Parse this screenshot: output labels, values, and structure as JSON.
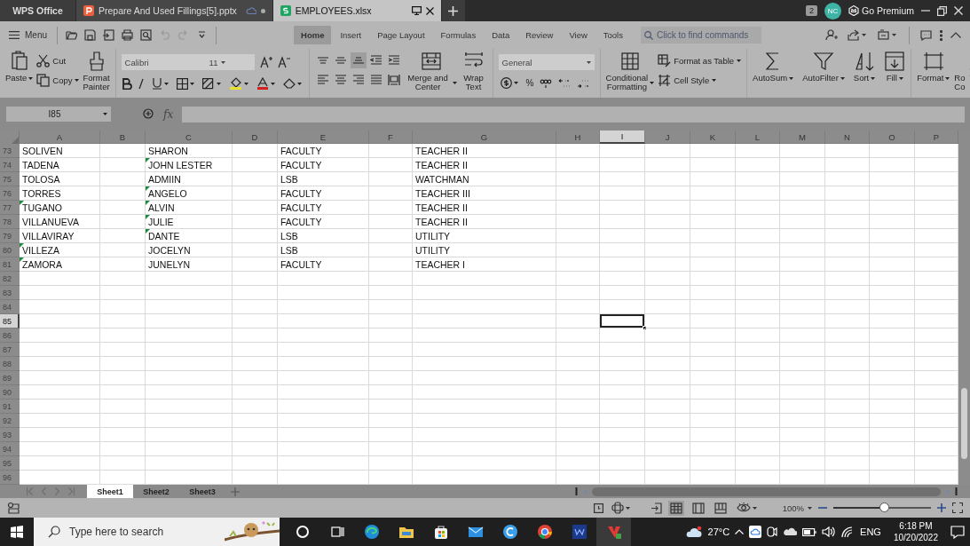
{
  "app_tabs": [
    {
      "label": "WPS Office",
      "kind": "home",
      "selected": false
    },
    {
      "label": "Prepare And Used Fillings[5].pptx",
      "kind": "presentation",
      "selected": false
    },
    {
      "label": "EMPLOYEES.xlsx",
      "kind": "spreadsheet",
      "selected": true
    }
  ],
  "title_bar": {
    "window_count": "2",
    "avatar": "NC",
    "premium": "Go Premium"
  },
  "menu": "Menu",
  "ribbon_tabs": [
    {
      "label": "Home",
      "selected": true
    },
    {
      "label": "Insert",
      "selected": false
    },
    {
      "label": "Page Layout",
      "selected": false
    },
    {
      "label": "Formulas",
      "selected": false
    },
    {
      "label": "Data",
      "selected": false
    },
    {
      "label": "Review",
      "selected": false
    },
    {
      "label": "View",
      "selected": false
    },
    {
      "label": "Tools",
      "selected": false
    }
  ],
  "command_search": {
    "placeholder": "Click to find commands"
  },
  "ribbon": {
    "paste": "Paste",
    "cut": "Cut",
    "copy": "Copy",
    "format_painter": "Format Painter",
    "font": "Calibri",
    "font_size": "11",
    "vertical_align": [
      {
        "selected": false
      },
      {
        "selected": false
      },
      {
        "selected": true
      }
    ],
    "merge": "Merge and Center",
    "wrap": "Wrap Text",
    "number_format": "General",
    "percent": "%",
    "conditional": "Conditional Formatting",
    "format_as_table": "Format as Table",
    "cell_style": "Cell Style",
    "autosum": "AutoSum",
    "autofilter": "AutoFilter",
    "sort": "Sort",
    "fill": "Fill",
    "format": "Format",
    "rows_columns": "Ro Co"
  },
  "formula_bar": {
    "name_box": "I85",
    "fx": "fx"
  },
  "sheet": {
    "columns": [
      {
        "label": "A",
        "selected": false
      },
      {
        "label": "B",
        "selected": false
      },
      {
        "label": "C",
        "selected": false
      },
      {
        "label": "D",
        "selected": false
      },
      {
        "label": "E",
        "selected": false
      },
      {
        "label": "F",
        "selected": false
      },
      {
        "label": "G",
        "selected": false
      },
      {
        "label": "H",
        "selected": false
      },
      {
        "label": "I",
        "selected": true
      },
      {
        "label": "J",
        "selected": false
      },
      {
        "label": "K",
        "selected": false
      },
      {
        "label": "L",
        "selected": false
      },
      {
        "label": "M",
        "selected": false
      },
      {
        "label": "N",
        "selected": false
      },
      {
        "label": "O",
        "selected": false
      },
      {
        "label": "P",
        "selected": false
      }
    ],
    "rows": [
      {
        "label": "73",
        "selected": false,
        "col_a": {
          "text": "SOLIVEN",
          "flagged": false
        },
        "col_c": {
          "text": "SHARON",
          "flagged": false
        },
        "col_e": {
          "text": "FACULTY",
          "flagged": false
        },
        "col_g": {
          "text": "TEACHER II",
          "flagged": false
        }
      },
      {
        "label": "74",
        "selected": false,
        "col_a": {
          "text": "TADENA",
          "flagged": false
        },
        "col_c": {
          "text": "JOHN LESTER",
          "flagged": true
        },
        "col_e": {
          "text": "FACULTY",
          "flagged": false
        },
        "col_g": {
          "text": "TEACHER II",
          "flagged": false
        }
      },
      {
        "label": "75",
        "selected": false,
        "col_a": {
          "text": "TOLOSA",
          "flagged": false
        },
        "col_c": {
          "text": "ADMIIN",
          "flagged": false
        },
        "col_e": {
          "text": "LSB",
          "flagged": false
        },
        "col_g": {
          "text": "WATCHMAN",
          "flagged": false
        }
      },
      {
        "label": "76",
        "selected": false,
        "col_a": {
          "text": "TORRES",
          "flagged": false
        },
        "col_c": {
          "text": "ANGELO",
          "flagged": true
        },
        "col_e": {
          "text": "FACULTY",
          "flagged": false
        },
        "col_g": {
          "text": "TEACHER III",
          "flagged": false
        }
      },
      {
        "label": "77",
        "selected": false,
        "col_a": {
          "text": "TUGANO",
          "flagged": true
        },
        "col_c": {
          "text": "ALVIN",
          "flagged": true
        },
        "col_e": {
          "text": "FACULTY",
          "flagged": false
        },
        "col_g": {
          "text": "TEACHER II",
          "flagged": false
        }
      },
      {
        "label": "78",
        "selected": false,
        "col_a": {
          "text": "VILLANUEVA",
          "flagged": false
        },
        "col_c": {
          "text": "JULIE",
          "flagged": true
        },
        "col_e": {
          "text": "FACULTY",
          "flagged": false
        },
        "col_g": {
          "text": "TEACHER II",
          "flagged": false
        }
      },
      {
        "label": "79",
        "selected": false,
        "col_a": {
          "text": "VILLAVIRAY",
          "flagged": false
        },
        "col_c": {
          "text": "DANTE",
          "flagged": true
        },
        "col_e": {
          "text": "LSB",
          "flagged": false
        },
        "col_g": {
          "text": "UTILITY",
          "flagged": false
        }
      },
      {
        "label": "80",
        "selected": false,
        "col_a": {
          "text": "VILLEZA",
          "flagged": true
        },
        "col_c": {
          "text": "JOCELYN",
          "flagged": false
        },
        "col_e": {
          "text": "LSB",
          "flagged": false
        },
        "col_g": {
          "text": "UTILITY",
          "flagged": false
        }
      },
      {
        "label": "81",
        "selected": false,
        "col_a": {
          "text": "ZAMORA",
          "flagged": true
        },
        "col_c": {
          "text": "JUNELYN",
          "flagged": false
        },
        "col_e": {
          "text": "FACULTY",
          "flagged": false
        },
        "col_g": {
          "text": "TEACHER I",
          "flagged": false
        }
      },
      {
        "label": "82",
        "selected": false
      },
      {
        "label": "83",
        "selected": false
      },
      {
        "label": "84",
        "selected": false
      },
      {
        "label": "85",
        "selected": true
      },
      {
        "label": "86",
        "selected": false
      },
      {
        "label": "87",
        "selected": false
      },
      {
        "label": "88",
        "selected": false
      },
      {
        "label": "89",
        "selected": false
      },
      {
        "label": "90",
        "selected": false
      },
      {
        "label": "91",
        "selected": false
      },
      {
        "label": "92",
        "selected": false
      },
      {
        "label": "93",
        "selected": false
      },
      {
        "label": "94",
        "selected": false
      },
      {
        "label": "95",
        "selected": false
      },
      {
        "label": "96",
        "selected": false
      }
    ]
  },
  "sheet_tabs": [
    {
      "label": "Sheet1",
      "selected": true
    },
    {
      "label": "Sheet2",
      "selected": false
    },
    {
      "label": "Sheet3",
      "selected": false
    }
  ],
  "status_bar": {
    "views": [
      {
        "selected": true
      },
      {
        "selected": false
      },
      {
        "selected": false
      }
    ],
    "zoom": "100%",
    "zoom_slider": {
      "level": 0.52
    }
  },
  "taskbar": {
    "search_placeholder": "Type here to search",
    "temperature": "27°C",
    "language": "ENG",
    "time": "6:18 PM",
    "date": "10/20/2022"
  }
}
